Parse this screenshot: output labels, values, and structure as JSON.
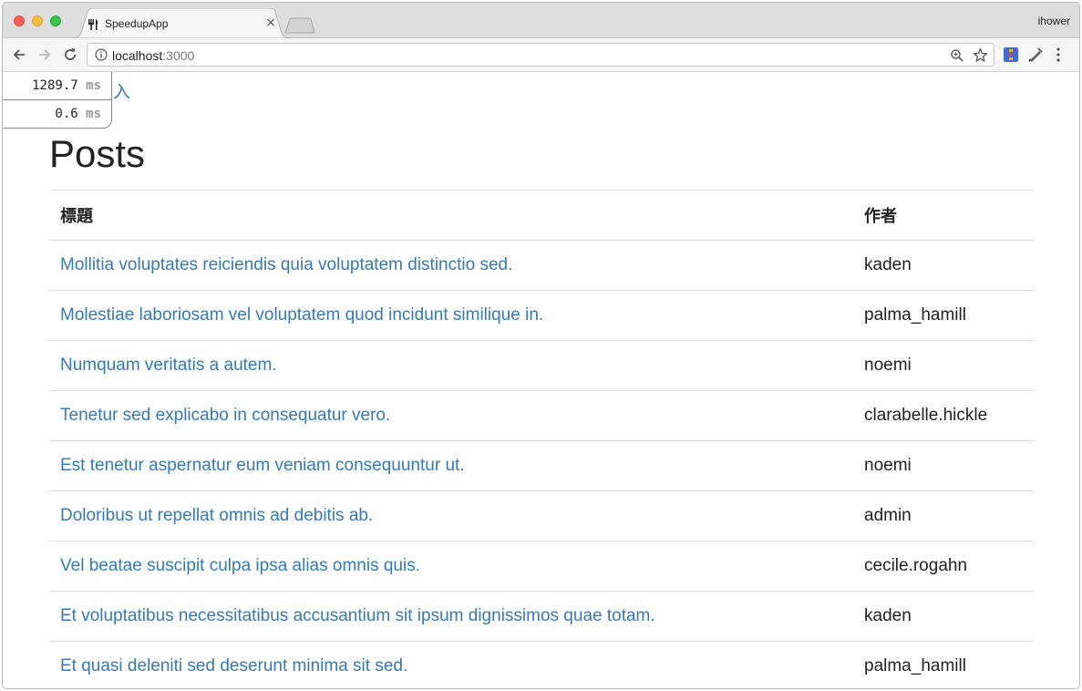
{
  "browser": {
    "tab_title": "SpeedupApp",
    "tab_close": "×",
    "profile_name": "ihower",
    "url_host": "localhost",
    "url_port": ":3000"
  },
  "profiler": {
    "rows": [
      {
        "value": "1289.7",
        "unit": "ms"
      },
      {
        "value": "0.6",
        "unit": "ms"
      }
    ]
  },
  "page": {
    "login_link": "登入",
    "title": "Posts",
    "table": {
      "headers": {
        "title": "標題",
        "author": "作者"
      },
      "rows": [
        {
          "title": "Mollitia voluptates reiciendis quia voluptatem distinctio sed.",
          "author": "kaden"
        },
        {
          "title": "Molestiae laboriosam vel voluptatem quod incidunt similique in.",
          "author": "palma_hamill"
        },
        {
          "title": "Numquam veritatis a autem.",
          "author": "noemi"
        },
        {
          "title": "Tenetur sed explicabo in consequatur vero.",
          "author": "clarabelle.hickle"
        },
        {
          "title": "Est tenetur aspernatur eum veniam consequuntur ut.",
          "author": "noemi"
        },
        {
          "title": "Doloribus ut repellat omnis ad debitis ab.",
          "author": "admin"
        },
        {
          "title": "Vel beatae suscipit culpa ipsa alias omnis quis.",
          "author": "cecile.rogahn"
        },
        {
          "title": "Et voluptatibus necessitatibus accusantium sit ipsum dignissimos quae totam.",
          "author": "kaden"
        },
        {
          "title": "Et quasi deleniti sed deserunt minima sit sed.",
          "author": "palma_hamill"
        }
      ]
    }
  }
}
